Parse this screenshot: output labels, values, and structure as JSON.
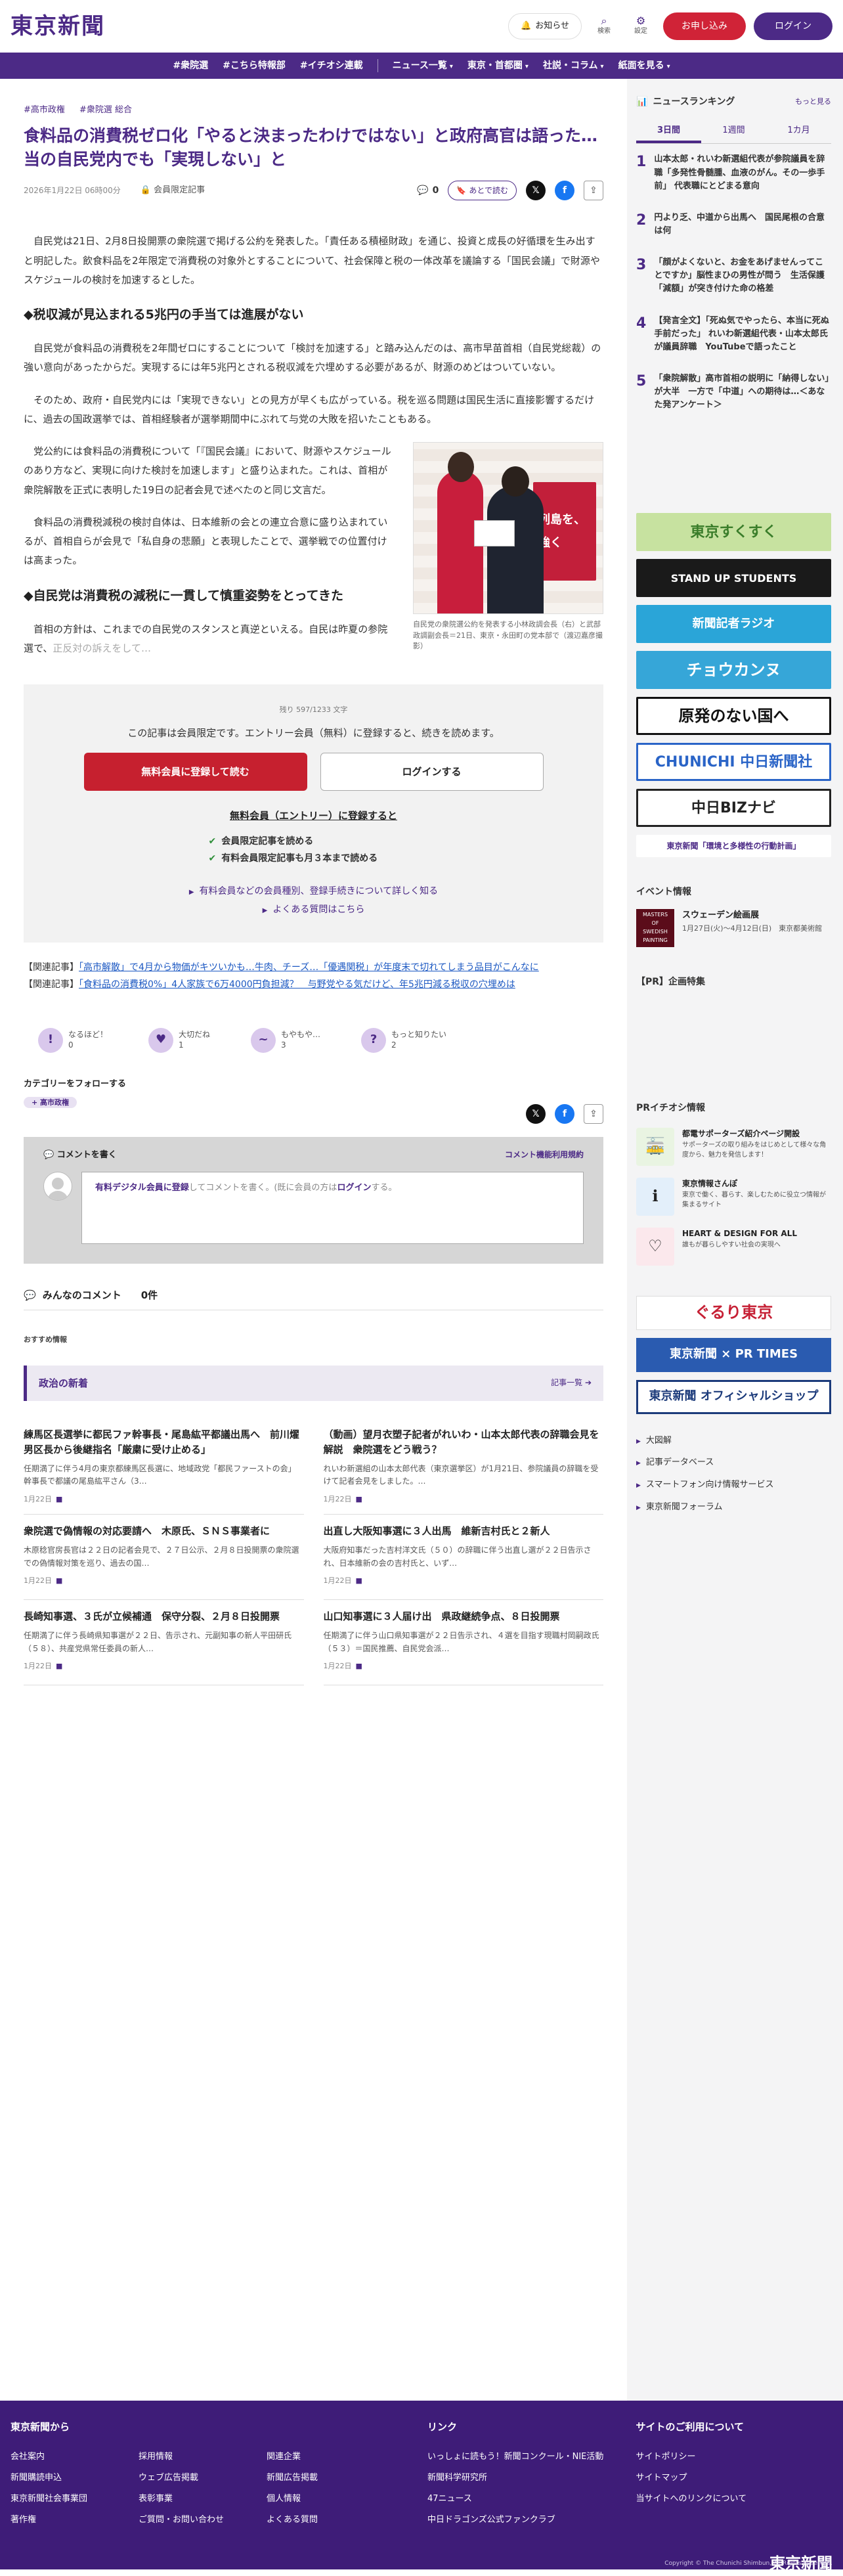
{
  "header": {
    "logo": "東京新聞",
    "notice": "お知らせ",
    "search": "検索",
    "settings": "設定",
    "subscribe": "お申し込み",
    "login": "ログイン"
  },
  "nav": [
    "#衆院選",
    "#こちら特報部",
    "#イチオシ連載",
    "ニュース一覧",
    "東京・首都圏",
    "社説・コラム",
    "紙面を見る"
  ],
  "article": {
    "tags": [
      "高市政権",
      "衆院選 総合"
    ],
    "title": "食料品の消費税ゼロ化「やると決まったわけではない」と政府高官は語った…当の自民党内でも「実現しない」と",
    "date": "2026年1月22日 06時00分",
    "lock_label": "会員限定記事",
    "comment_count": "0",
    "later_label": "あとで読む",
    "p1": "自民党は21日、2月8日投開票の衆院選で掲げる公約を発表した。「責任ある積極財政」を通じ、投資と成長の好循環を生み出すと明記した。飲食料品を2年限定で消費税の対象外とすることについて、社会保障と税の一体改革を議論する「国民会議」で財源やスケジュールの検討を加速するとした。",
    "h2a": "◆税収減が見込まれる5兆円の手当ては進展がない",
    "p2": "自民党が食料品の消費税を2年間ゼロにすることについて「検討を加速する」と踏み込んだのは、高市早苗首相（自民党総裁）の強い意向があったからだ。実現するには年5兆円とされる税収減を穴埋めする必要があるが、財源のめどはついていない。",
    "p3": "そのため、政府・自民党内には「実現できない」との見方が早くも広がっている。税を巡る問題は国民生活に直接影響するだけに、過去の国政選挙では、首相経験者が選挙期間中にぶれて与党の大敗を招いたこともある。",
    "p4": "党公約には食料品の消費税について「『国民会議』において、財源やスケジュールのあり方など、実現に向けた検討を加速します」と盛り込まれた。これは、首相が衆院解散を正式に表明した19日の記者会見で述べたのと同じ文言だ。",
    "p5": "食料品の消費税減税の検討自体は、日本維新の会との連立合意に盛り込まれているが、首相自らが会見で「私自身の悲願」と表現したことで、選挙戦での位置付けは高まった。",
    "h2b": "◆自民党は消費税の減税に一貫して慎重姿勢をとってきた",
    "p6": "首相の方針は、これまでの自民党のスタンスと真逆といえる。自民は昨夏の参院選で、",
    "p6_fade": "正反対の訴えをして…",
    "photo_banner": "列島を、強く",
    "photo_caption": "自民党の衆院選公約を発表する小林政調会長（右）と武部政調副会長＝21日、東京・永田町の党本部で（渡辺嘉彦撮影）"
  },
  "paywall": {
    "count": "残り 597/1233 文字",
    "lead": "この記事は会員限定です。エントリー会員（無料）に登録すると、続きを読めます。",
    "register": "無料会員に登録して読む",
    "login": "ログインする",
    "sub_title": "無料会員（エントリー）に登録すると",
    "checks": [
      "会員限定記事を読める",
      "有料会員限定記事も月３本まで読める"
    ],
    "links": [
      "有料会員などの会員種別、登録手続きについて詳しく知る",
      "よくある質問はこちら"
    ]
  },
  "related": [
    {
      "label": "【関連記事】",
      "text": "「高市解散」で4月から物価がキツいかも…牛肉、チーズ…「優遇関税」が年度末で切れてしまう品目がこんなに"
    },
    {
      "label": "【関連記事】",
      "text": "「食料品の消費税0%」4人家族で6万4000円負担減？　与野党やる気だけど、年5兆円減る税収の穴埋めは"
    }
  ],
  "reactions": [
    {
      "label": "なるほど！",
      "count": "0"
    },
    {
      "label": "大切だね",
      "count": "1"
    },
    {
      "label": "もやもや…",
      "count": "3"
    },
    {
      "label": "もっと知りたい",
      "count": "2"
    }
  ],
  "follow": {
    "title": "カテゴリーをフォローする",
    "tag": "高市政権"
  },
  "comments": {
    "write": "コメントを書く",
    "guideline": "コメント機能利用規約",
    "input_link": "有料デジタル会員に登録",
    "input_text1": "してコメントを書く。(既に会員の方は",
    "input_login": "ログイン",
    "input_text2": "する。",
    "everyone": "みんなのコメント",
    "everyone_count": "0件"
  },
  "recommend": {
    "label": "おすすめ情報",
    "section": "政治の新着",
    "more": "記事一覧",
    "cards": [
      {
        "title": "練馬区長選挙に都民ファ幹事長・尾島紘平都議出馬へ　前川燿男区長から後継指名「厳粛に受け止める」",
        "summary": "任期満了に伴う4月の東京都練馬区長選に、地域政党「都民ファーストの会」幹事長で都議の尾島紘平さん（3…",
        "date": "1月22日"
      },
      {
        "title": "（動画）望月衣塑子記者がれいわ・山本太郎代表の辞職会見を解説　衆院選をどう戦う？",
        "summary": "れいわ新選組の山本太郎代表（東京選挙区）が1月21日、参院議員の辞職を受けて記者会見をしました。…",
        "date": "1月22日"
      },
      {
        "title": "衆院選で偽情報の対応要請へ　木原氏、ＳＮＳ事業者に",
        "summary": "木原稔官房長官は２２日の記者会見で、２７日公示、２月８日投開票の衆院選での偽情報対策を巡り、過去の国…",
        "date": "1月22日"
      },
      {
        "title": "出直し大阪知事選に３人出馬　維新吉村氏と２新人",
        "summary": "大阪府知事だった吉村洋文氏（５０）の辞職に伴う出直し選が２２日告示され、日本維新の会の吉村氏と、いず…",
        "date": "1月22日"
      },
      {
        "title": "長崎知事選、３氏が立候補通　保守分裂、２月８日投開票",
        "summary": "任期満了に伴う長崎県知事選が２２日、告示され、元副知事の新人平田研氏（５８）、共産党県常任委員の新人…",
        "date": "1月22日"
      },
      {
        "title": "山口知事選に３人届け出　県政継続争点、８日投開票",
        "summary": "任期満了に伴う山口県知事選が２２日告示され、４選を目指す現職村岡嗣政氏（５３）＝国民推薦、自民党会派…",
        "date": "1月22日"
      }
    ]
  },
  "sidebar": {
    "ranking_title": "ニュースランキング",
    "ranking_more": "もっと見る",
    "tabs": [
      "3日間",
      "1週間",
      "1カ月"
    ],
    "ranking": [
      "山本太郎・れいわ新選組代表が参院議員を辞職「多発性骨髄腫、血液のがん。その一歩手前」 代表職にとどまる意向",
      "円より乏、中道から出馬へ　国民尾根の合意は何",
      "「顔がよくないと、お金をあげませんってことですか」脳性まひの男性が問う　生活保護「減額」が突き付けた命の格差",
      "【発言全文】「死ぬ気でやったら、本当に死ぬ手前だった」 れいわ新選組代表・山本太郎氏が議員辞職　YouTubeで語ったこと",
      "「衆院解散」高市首相の説明に「納得しない」が大半　一方で「中道」への期待は…＜あなた発アンケート＞"
    ],
    "banners": [
      "東京すくすく",
      "STAND UP STUDENTS",
      "新聞記者ラジオ",
      "チョウカンヌ",
      "原発のない国へ",
      "CHUNICHI 中日新聞社",
      "中日BIZナビ",
      "東京新聞「環境と多様性の行動計画」"
    ],
    "events_title": "イベント情報",
    "event": {
      "img": "MASTERS OF SWEDISH PAINTING",
      "title": "スウェーデン絵画展",
      "sub": "1月27日(火)〜4月12日(日)　東京都美術館"
    },
    "pr_title": "【PR】企画特集",
    "pr_ichioshi": "PRイチオシ情報",
    "pr": [
      {
        "title": "都電サポーターズ紹介ページ開設",
        "sub": "サポーターズの取り組みをはじめとして様々な角度から、魅力を発信します！"
      },
      {
        "title": "東京情報さんぽ",
        "sub": "東京で働く、暮らす、楽しむために役立つ情報が集まるサイト"
      },
      {
        "title": "HEART & DESIGN FOR ALL",
        "sub": "誰もが暮らしやすい社会の実現へ"
      }
    ],
    "brands": [
      "ぐるり東京",
      "東京新聞 × PR TIMES",
      "東京新聞 オフィシャルショップ"
    ],
    "links": [
      "大図解",
      "記事データベース",
      "スマートフォン向け情報サービス",
      "東京新聞フォーラム"
    ]
  },
  "footer": {
    "col1_title": "東京新聞から",
    "col1_links": [
      "会社案内",
      "採用情報",
      "関連企業",
      "新聞購読申込",
      "ウェブ広告掲載",
      "新聞広告掲載",
      "東京新聞社会事業団",
      "表彰事業",
      "個人情報",
      "著作権",
      "ご質問・お問い合わせ",
      "よくある質問"
    ],
    "col2_title": "リンク",
    "col2_links": [
      "いっしょに読もう！新聞コンクール・NIE活動",
      "新聞科学研究所",
      "47ニュース",
      "中日ドラゴンズ公式ファンクラブ"
    ],
    "col3_title": "サイトのご利用について",
    "col3_links": [
      "サイトポリシー",
      "サイトマップ",
      "当サイトへのリンクについて"
    ],
    "logo": "東京新聞",
    "copyright": "Copyright © The Chunichi Shimbun, All Rights Reserved."
  }
}
